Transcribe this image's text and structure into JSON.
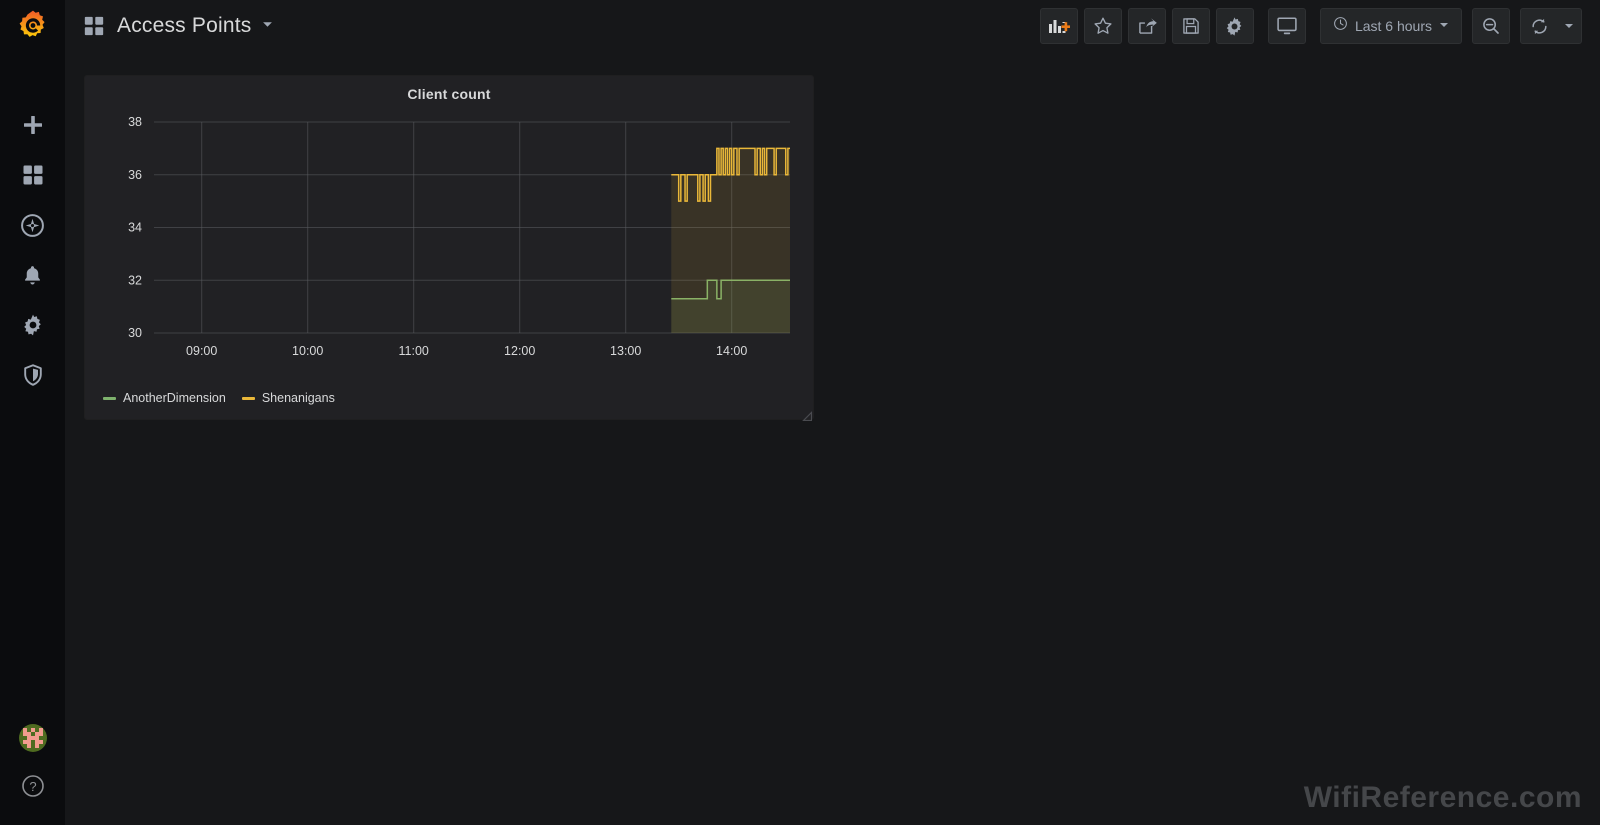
{
  "app": {
    "brand_icon": "grafana-logo-icon",
    "background": "#161719",
    "sidebar_background": "#0b0c0e"
  },
  "sidebar": {
    "items": [
      {
        "name": "create",
        "icon": "plus-icon",
        "label": "Create"
      },
      {
        "name": "dashboards",
        "icon": "dashboards-grid-icon",
        "label": "Dashboards"
      },
      {
        "name": "explore",
        "icon": "compass-icon",
        "label": "Explore"
      },
      {
        "name": "alerting",
        "icon": "bell-icon",
        "label": "Alerting"
      },
      {
        "name": "configuration",
        "icon": "gear-icon",
        "label": "Configuration"
      },
      {
        "name": "server-admin",
        "icon": "shield-icon",
        "label": "Server Admin"
      }
    ],
    "bottom": [
      {
        "name": "user-avatar",
        "icon": "avatar-icon",
        "label": "User"
      },
      {
        "name": "help",
        "icon": "question-circle-icon",
        "label": "Help"
      }
    ]
  },
  "header": {
    "dashboard_icon": "dashboards-grid-icon",
    "title": "Access Points",
    "caret_icon": "chevron-down-icon",
    "actions": [
      {
        "name": "add-panel",
        "icon": "add-panel-icon",
        "label": "Add panel"
      },
      {
        "name": "mark-favorite",
        "icon": "star-icon",
        "label": "Mark as favorite"
      },
      {
        "name": "share-dashboard",
        "icon": "share-icon",
        "label": "Share dashboard"
      },
      {
        "name": "save-dashboard",
        "icon": "save-floppy-icon",
        "label": "Save dashboard"
      },
      {
        "name": "dashboard-settings",
        "icon": "gear-icon",
        "label": "Dashboard settings"
      },
      {
        "name": "cycle-view-mode",
        "icon": "monitor-icon",
        "label": "Cycle view mode"
      }
    ],
    "time_picker": {
      "icon": "clock-icon",
      "value": "Last 6 hours",
      "caret_icon": "chevron-down-icon"
    },
    "zoom_out": {
      "icon": "zoom-out-icon",
      "label": "Zoom out time range"
    },
    "refresh": {
      "icon": "refresh-icon",
      "label": "Refresh dashboard",
      "caret_icon": "chevron-down-icon"
    }
  },
  "panel": {
    "title": "Client count",
    "resize_handle": "panel-resize-handle"
  },
  "watermark": {
    "text": "WifiReference.com"
  },
  "chart_data": {
    "type": "line",
    "title": "Client count",
    "xlabel": "",
    "ylabel": "",
    "ylim": [
      30,
      38
    ],
    "yticks": [
      30,
      32,
      34,
      36,
      38
    ],
    "xticks": [
      "09:00",
      "10:00",
      "11:00",
      "12:00",
      "13:00",
      "14:00"
    ],
    "x_range": [
      "08:33",
      "14:33"
    ],
    "grid": true,
    "legend_position": "bottom-left",
    "fill_area": true,
    "fill_opacity": 0.12,
    "line_width": 1.5,
    "series": [
      {
        "name": "AnotherDimension",
        "color": "#7eb26d",
        "points": [
          [
            13.43,
            31.3
          ],
          [
            13.77,
            31.3
          ],
          [
            13.77,
            32.0
          ],
          [
            13.86,
            32.0
          ],
          [
            13.86,
            31.3
          ],
          [
            13.9,
            31.3
          ],
          [
            13.9,
            32.0
          ],
          [
            14.55,
            32.0
          ]
        ]
      },
      {
        "name": "Shenanigans",
        "color": "#eab839",
        "points": [
          [
            13.43,
            36.0
          ],
          [
            13.5,
            36.0
          ],
          [
            13.5,
            35.0
          ],
          [
            13.52,
            35.0
          ],
          [
            13.52,
            36.0
          ],
          [
            13.56,
            36.0
          ],
          [
            13.56,
            35.0
          ],
          [
            13.58,
            35.0
          ],
          [
            13.58,
            36.0
          ],
          [
            13.68,
            36.0
          ],
          [
            13.68,
            35.0
          ],
          [
            13.7,
            35.0
          ],
          [
            13.7,
            36.0
          ],
          [
            13.73,
            36.0
          ],
          [
            13.73,
            35.0
          ],
          [
            13.75,
            35.0
          ],
          [
            13.75,
            36.0
          ],
          [
            13.78,
            36.0
          ],
          [
            13.78,
            35.0
          ],
          [
            13.8,
            35.0
          ],
          [
            13.8,
            36.0
          ],
          [
            13.86,
            36.0
          ],
          [
            13.86,
            37.0
          ],
          [
            13.88,
            37.0
          ],
          [
            13.88,
            36.0
          ],
          [
            13.9,
            36.0
          ],
          [
            13.9,
            37.0
          ],
          [
            13.92,
            37.0
          ],
          [
            13.92,
            36.0
          ],
          [
            13.94,
            36.0
          ],
          [
            13.94,
            37.0
          ],
          [
            13.96,
            37.0
          ],
          [
            13.96,
            36.0
          ],
          [
            13.98,
            36.0
          ],
          [
            13.98,
            37.0
          ],
          [
            14.0,
            37.0
          ],
          [
            14.0,
            36.0
          ],
          [
            14.02,
            36.0
          ],
          [
            14.02,
            37.0
          ],
          [
            14.05,
            37.0
          ],
          [
            14.05,
            36.0
          ],
          [
            14.07,
            36.0
          ],
          [
            14.07,
            37.0
          ],
          [
            14.22,
            37.0
          ],
          [
            14.22,
            36.0
          ],
          [
            14.24,
            36.0
          ],
          [
            14.24,
            37.0
          ],
          [
            14.27,
            37.0
          ],
          [
            14.27,
            36.0
          ],
          [
            14.29,
            36.0
          ],
          [
            14.29,
            37.0
          ],
          [
            14.31,
            37.0
          ],
          [
            14.31,
            36.0
          ],
          [
            14.33,
            36.0
          ],
          [
            14.33,
            37.0
          ],
          [
            14.4,
            37.0
          ],
          [
            14.4,
            36.0
          ],
          [
            14.42,
            36.0
          ],
          [
            14.42,
            37.0
          ],
          [
            14.51,
            37.0
          ],
          [
            14.51,
            36.0
          ],
          [
            14.53,
            36.0
          ],
          [
            14.53,
            37.0
          ],
          [
            14.55,
            37.0
          ]
        ]
      }
    ]
  }
}
